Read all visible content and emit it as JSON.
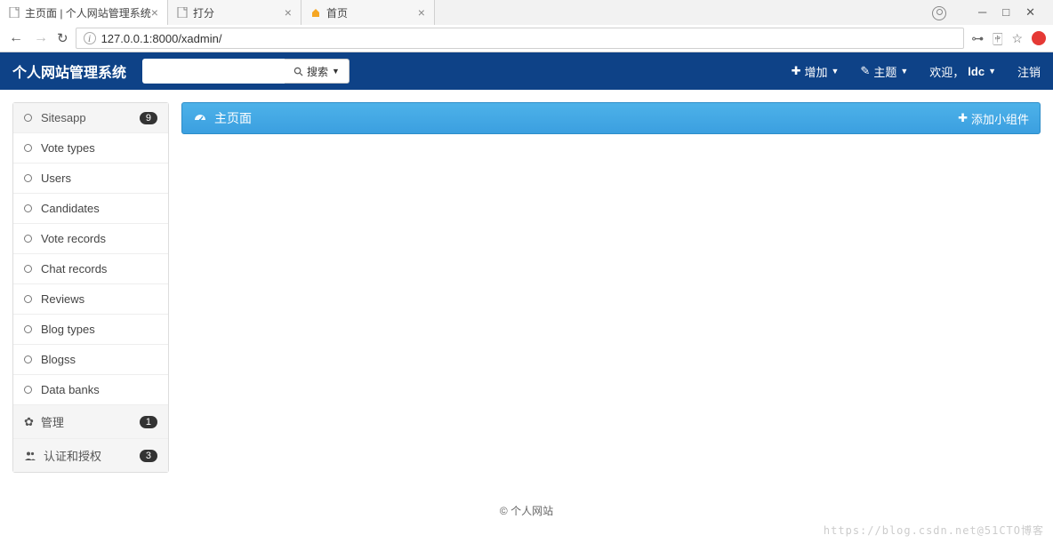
{
  "browser": {
    "tabs": [
      {
        "title": "主页面 | 个人网站管理系统",
        "active": true
      },
      {
        "title": "打分",
        "active": false
      },
      {
        "title": "首页",
        "active": false
      }
    ],
    "url": "127.0.0.1:8000/xadmin/"
  },
  "navbar": {
    "brand": "个人网站管理系统",
    "search_btn": "搜索",
    "add": "增加",
    "theme": "主题",
    "welcome": "欢迎，",
    "user": "ldc",
    "logout": "注销"
  },
  "sidebar": {
    "groups": [
      {
        "type": "head",
        "icon": "bullet",
        "label": "Sitesapp",
        "badge": "9"
      },
      {
        "type": "item",
        "icon": "bullet",
        "label": "Vote types"
      },
      {
        "type": "item",
        "icon": "bullet",
        "label": "Users"
      },
      {
        "type": "item",
        "icon": "bullet",
        "label": "Candidates"
      },
      {
        "type": "item",
        "icon": "bullet",
        "label": "Vote records"
      },
      {
        "type": "item",
        "icon": "bullet",
        "label": "Chat records"
      },
      {
        "type": "item",
        "icon": "bullet",
        "label": "Reviews"
      },
      {
        "type": "item",
        "icon": "bullet",
        "label": "Blog types"
      },
      {
        "type": "item",
        "icon": "bullet",
        "label": "Blogss"
      },
      {
        "type": "item",
        "icon": "bullet",
        "label": "Data banks"
      },
      {
        "type": "head",
        "icon": "gear",
        "label": "管理",
        "badge": "1"
      },
      {
        "type": "head",
        "icon": "users",
        "label": "认证和授权",
        "badge": "3"
      }
    ]
  },
  "panel": {
    "title": "主页面",
    "add_widget": "添加小组件"
  },
  "footer": "© 个人网站",
  "watermark": "https://blog.csdn.net@51CTO博客"
}
